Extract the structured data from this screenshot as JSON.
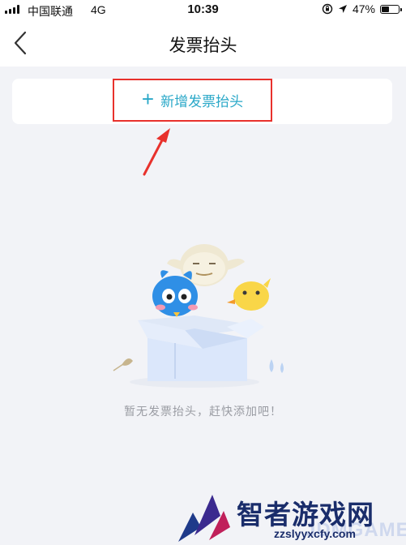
{
  "status_bar": {
    "carrier": "中国联通",
    "network": "4G",
    "time": "10:39",
    "battery": "47%",
    "battery_level": 0.47,
    "icons": [
      "signal-icon",
      "orientation-lock-icon",
      "location-arrow-icon",
      "battery-icon"
    ]
  },
  "nav": {
    "title": "发票抬头",
    "back_icon": "chevron-left-icon"
  },
  "add_card": {
    "button_label": "新增发票抬头",
    "icon": "plus-icon",
    "accent_color": "#2aa8c8",
    "highlight_color": "#e8312c"
  },
  "empty_state": {
    "message": "暂无发票抬头，赶快添加吧！",
    "illustration": "mascot-box-illustration"
  },
  "watermark": {
    "title": "智者游戏网",
    "subtitle": "zzslyyxcfy.com",
    "ghost_text": "JDMGAME"
  }
}
